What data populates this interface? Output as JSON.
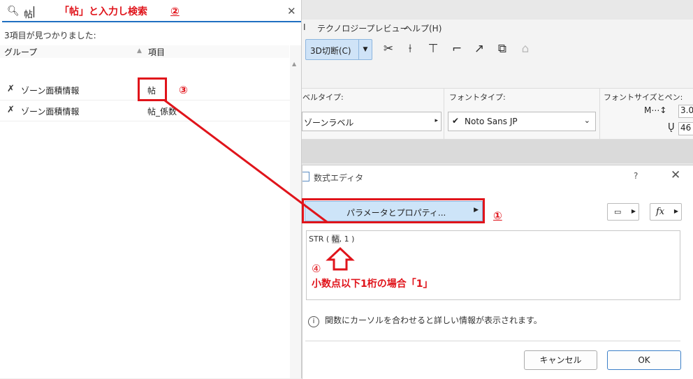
{
  "search": {
    "query": "帖",
    "found_text": "3項目が見つかりました:",
    "headers": {
      "group": "グループ",
      "item": "項目"
    },
    "rows": [
      {
        "group": "ゾーン面積情報",
        "item": "帖"
      },
      {
        "group": "ゾーン面積情報",
        "item": "帖_係数"
      }
    ]
  },
  "menu": {
    "items": [
      "I",
      "テクノロジープレビュー",
      "ヘルプ(H)"
    ]
  },
  "toolbar": {
    "section_cut_label": "3D切断(C)"
  },
  "info_box": {
    "label_type_title": "ベルタイプ:",
    "label_type_value": "ゾーンラベル",
    "font_type_title": "フォントタイプ:",
    "font_type_value": "Noto Sans JP",
    "font_size_title": "フォントサイズとペン:",
    "font_size_value": "3.0",
    "pen_value": "46"
  },
  "dialog": {
    "title": "数式エディタ",
    "help": "?",
    "param_button": "パラメータとプロパティ...",
    "code_prefix": "STR ( ",
    "code_highlight": "帖",
    "code_suffix": ", 1 )",
    "info_text": "関数にカーソルを合わせると詳しい情報が表示されます。",
    "cancel": "キャンセル",
    "ok": "OK",
    "fx_label": "fx"
  },
  "annotations": {
    "step1": "①",
    "step2": "②",
    "step3": "③",
    "step4": "④",
    "search_note": "「帖」と入力し検索",
    "decimal_note": "小数点以下1桁の場合「1」"
  },
  "colors": {
    "annotation_red": "#e0141b",
    "accent_blue": "#1f6fc1"
  }
}
